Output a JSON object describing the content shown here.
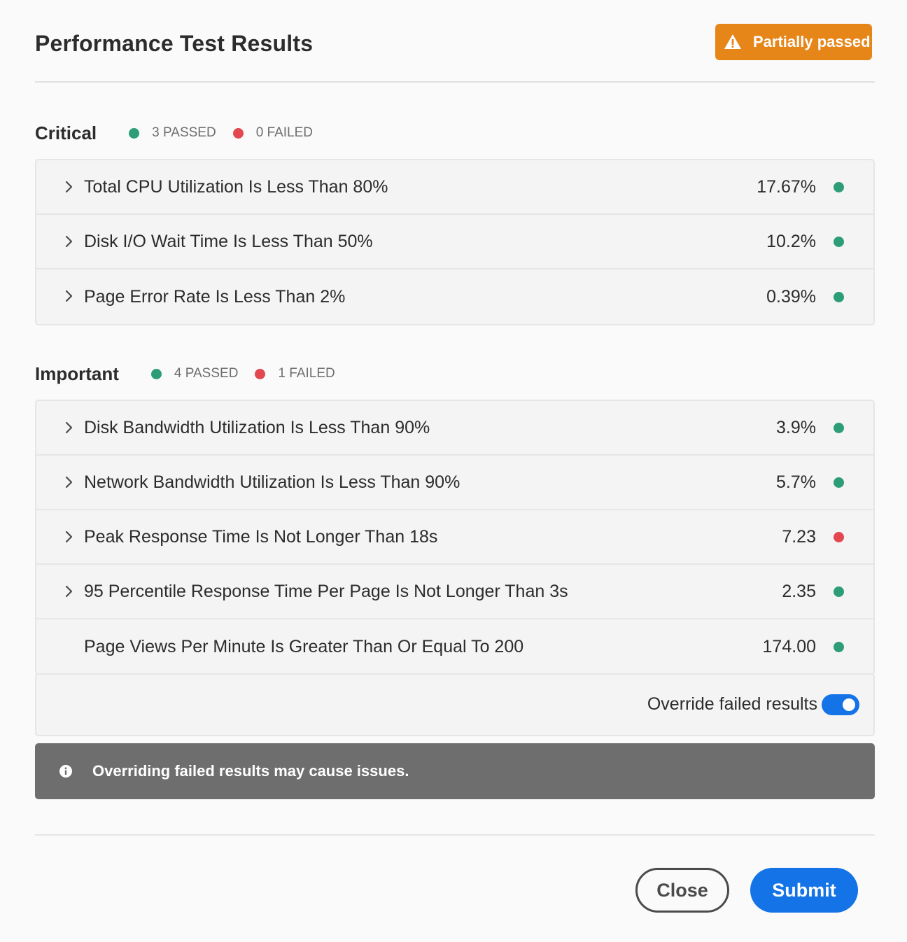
{
  "dialog": {
    "title": "Performance Test Results",
    "status_badge": "Partially passed"
  },
  "colors": {
    "badge": "#e68619",
    "passed": "#2d9d78",
    "failed": "#e34850",
    "accent": "#1473e6",
    "info_bar": "#6e6e6e"
  },
  "sections": [
    {
      "title": "Critical",
      "passed_label": "3 PASSED",
      "failed_label": "0 FAILED",
      "rows": [
        {
          "label": "Total CPU Utilization Is Less Than 80%",
          "value": "17.67%",
          "status": "passed",
          "expandable": true
        },
        {
          "label": "Disk I/O Wait Time Is Less Than 50%",
          "value": "10.2%",
          "status": "passed",
          "expandable": true
        },
        {
          "label": "Page Error Rate Is Less Than 2%",
          "value": "0.39%",
          "status": "passed",
          "expandable": true
        }
      ]
    },
    {
      "title": "Important",
      "passed_label": "4 PASSED",
      "failed_label": "1 FAILED",
      "rows": [
        {
          "label": "Disk Bandwidth Utilization Is Less Than 90%",
          "value": "3.9%",
          "status": "passed",
          "expandable": true
        },
        {
          "label": "Network Bandwidth Utilization Is Less Than 90%",
          "value": "5.7%",
          "status": "passed",
          "expandable": true
        },
        {
          "label": "Peak Response Time Is Not Longer Than 18s",
          "value": "7.23",
          "status": "failed",
          "expandable": true
        },
        {
          "label": "95 Percentile Response Time Per Page Is Not Longer Than 3s",
          "value": "2.35",
          "status": "passed",
          "expandable": true
        },
        {
          "label": "Page Views Per Minute Is Greater Than Or Equal To 200",
          "value": "174.00",
          "status": "passed",
          "expandable": false
        }
      ]
    }
  ],
  "override": {
    "label": "Override failed results",
    "enabled": true
  },
  "info": {
    "icon": "info-icon",
    "message": "Overriding failed results may cause issues."
  },
  "footer": {
    "close_label": "Close",
    "submit_label": "Submit"
  }
}
